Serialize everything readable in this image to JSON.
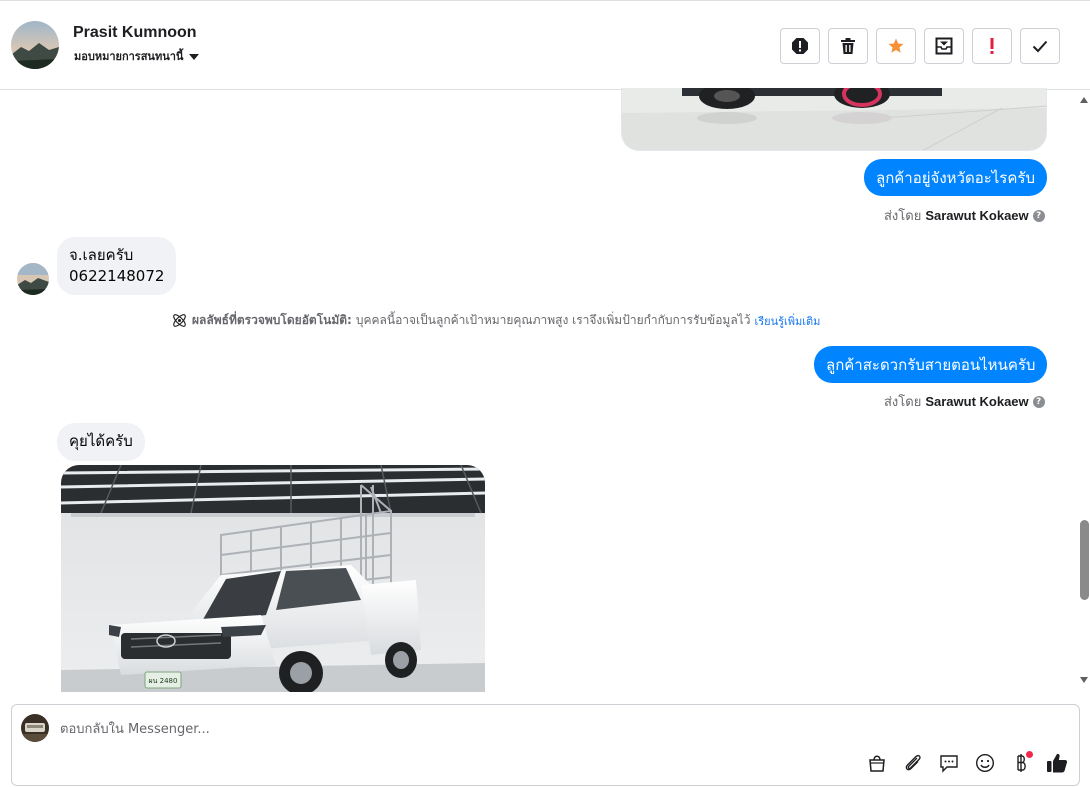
{
  "header": {
    "contact_name": "Prasit Kumnoon",
    "assign_label": "มอบหมายการสนทนานี้",
    "actions": [
      "mark-spam-icon",
      "trash-icon",
      "star-icon",
      "archive-icon",
      "follow-up-icon",
      "done-icon"
    ],
    "star_color": "#f7923b",
    "follow_up_color": "#e41e3f"
  },
  "thread": {
    "msg1_text": "ลูกค้าอยู่จังหวัดอะไรครับ",
    "sent_by_prefix_1": "ส่งโดย",
    "sent_by_name_1": "Sarawut Kokaew",
    "reply1_line1": "จ.เลยครับ",
    "reply1_line2": "0622148072",
    "notice_bold": "ผลลัพธ์ที่ตรวจพบโดยอัตโนมัติ:",
    "notice_text": "บุคคลนี้อาจเป็นลูกค้าเป้าหมายคุณภาพสูง เราจึงเพิ่มป้ายกำกับการรับข้อมูลไว้",
    "notice_link": "เรียนรู้เพิ่มเติม",
    "msg2_text": "ลูกค้าสะดวกรับสายตอนไหนครับ",
    "sent_by_prefix_2": "ส่งโดย",
    "sent_by_name_2": "Sarawut Kokaew",
    "reply2_text": "คุยได้ครับ",
    "plate_text": "ผน 2480"
  },
  "composer": {
    "placeholder": "ตอบกลับใน Messenger...",
    "tools": [
      "bag-icon",
      "paperclip-icon",
      "saved-reply-icon",
      "emoji-icon",
      "baht-icon",
      "thumbs-up-icon"
    ]
  },
  "colors": {
    "outgoing_bubble": "#0084ff",
    "incoming_bubble": "#f0f2f5",
    "link": "#1877f2"
  }
}
